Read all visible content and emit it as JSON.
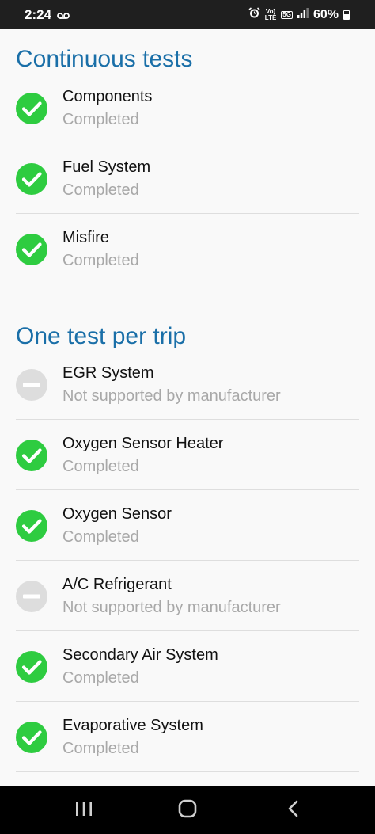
{
  "status_bar": {
    "time": "2:24",
    "signal_label_top": "Vo)",
    "signal_label_bottom": "LTE",
    "network_label": "5G",
    "battery": "60%"
  },
  "sections": [
    {
      "title": "Continuous tests",
      "items": [
        {
          "name": "Components",
          "status": "Completed",
          "icon": "check-circle-icon"
        },
        {
          "name": "Fuel System",
          "status": "Completed",
          "icon": "check-circle-icon"
        },
        {
          "name": "Misfire",
          "status": "Completed",
          "icon": "check-circle-icon"
        }
      ]
    },
    {
      "title": "One test per trip",
      "items": [
        {
          "name": "EGR System",
          "status": "Not supported by manufacturer",
          "icon": "not-supported-icon"
        },
        {
          "name": "Oxygen Sensor Heater",
          "status": "Completed",
          "icon": "check-circle-icon"
        },
        {
          "name": "Oxygen Sensor",
          "status": "Completed",
          "icon": "check-circle-icon"
        },
        {
          "name": "A/C Refrigerant",
          "status": "Not supported by manufacturer",
          "icon": "not-supported-icon"
        },
        {
          "name": "Secondary Air System",
          "status": "Completed",
          "icon": "check-circle-icon"
        },
        {
          "name": "Evaporative System",
          "status": "Completed",
          "icon": "check-circle-icon"
        }
      ]
    }
  ],
  "colors": {
    "accent": "#1a6fa8",
    "check": "#2ecc40",
    "not_supported": "#dddddd"
  }
}
